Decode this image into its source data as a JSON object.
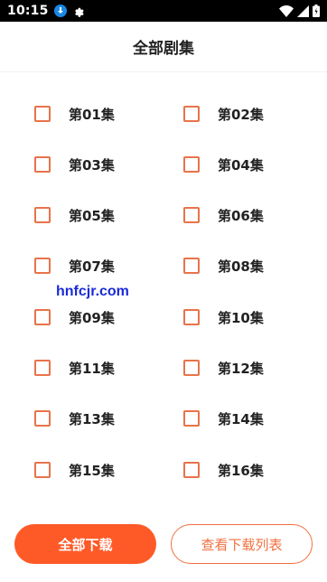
{
  "status_bar": {
    "time": "10:15",
    "icons": [
      "download-icon",
      "gear-icon",
      "wifi-icon",
      "signal-icon",
      "battery-icon"
    ]
  },
  "header": {
    "title": "全部剧集"
  },
  "episodes": [
    {
      "label": "第01集",
      "checked": false
    },
    {
      "label": "第02集",
      "checked": false
    },
    {
      "label": "第03集",
      "checked": false
    },
    {
      "label": "第04集",
      "checked": false
    },
    {
      "label": "第05集",
      "checked": false
    },
    {
      "label": "第06集",
      "checked": false
    },
    {
      "label": "第07集",
      "checked": false
    },
    {
      "label": "第08集",
      "checked": false
    },
    {
      "label": "第09集",
      "checked": false
    },
    {
      "label": "第10集",
      "checked": false
    },
    {
      "label": "第11集",
      "checked": false
    },
    {
      "label": "第12集",
      "checked": false
    },
    {
      "label": "第13集",
      "checked": false
    },
    {
      "label": "第14集",
      "checked": false
    },
    {
      "label": "第15集",
      "checked": false
    },
    {
      "label": "第16集",
      "checked": false
    }
  ],
  "watermark": "hnfcjr.com",
  "footer": {
    "download_all_label": "全部下载",
    "view_downloads_label": "查看下载列表"
  },
  "colors": {
    "accent": "#fe5a28",
    "checkbox_border": "#e8734a",
    "watermark": "#1a2bd6"
  }
}
